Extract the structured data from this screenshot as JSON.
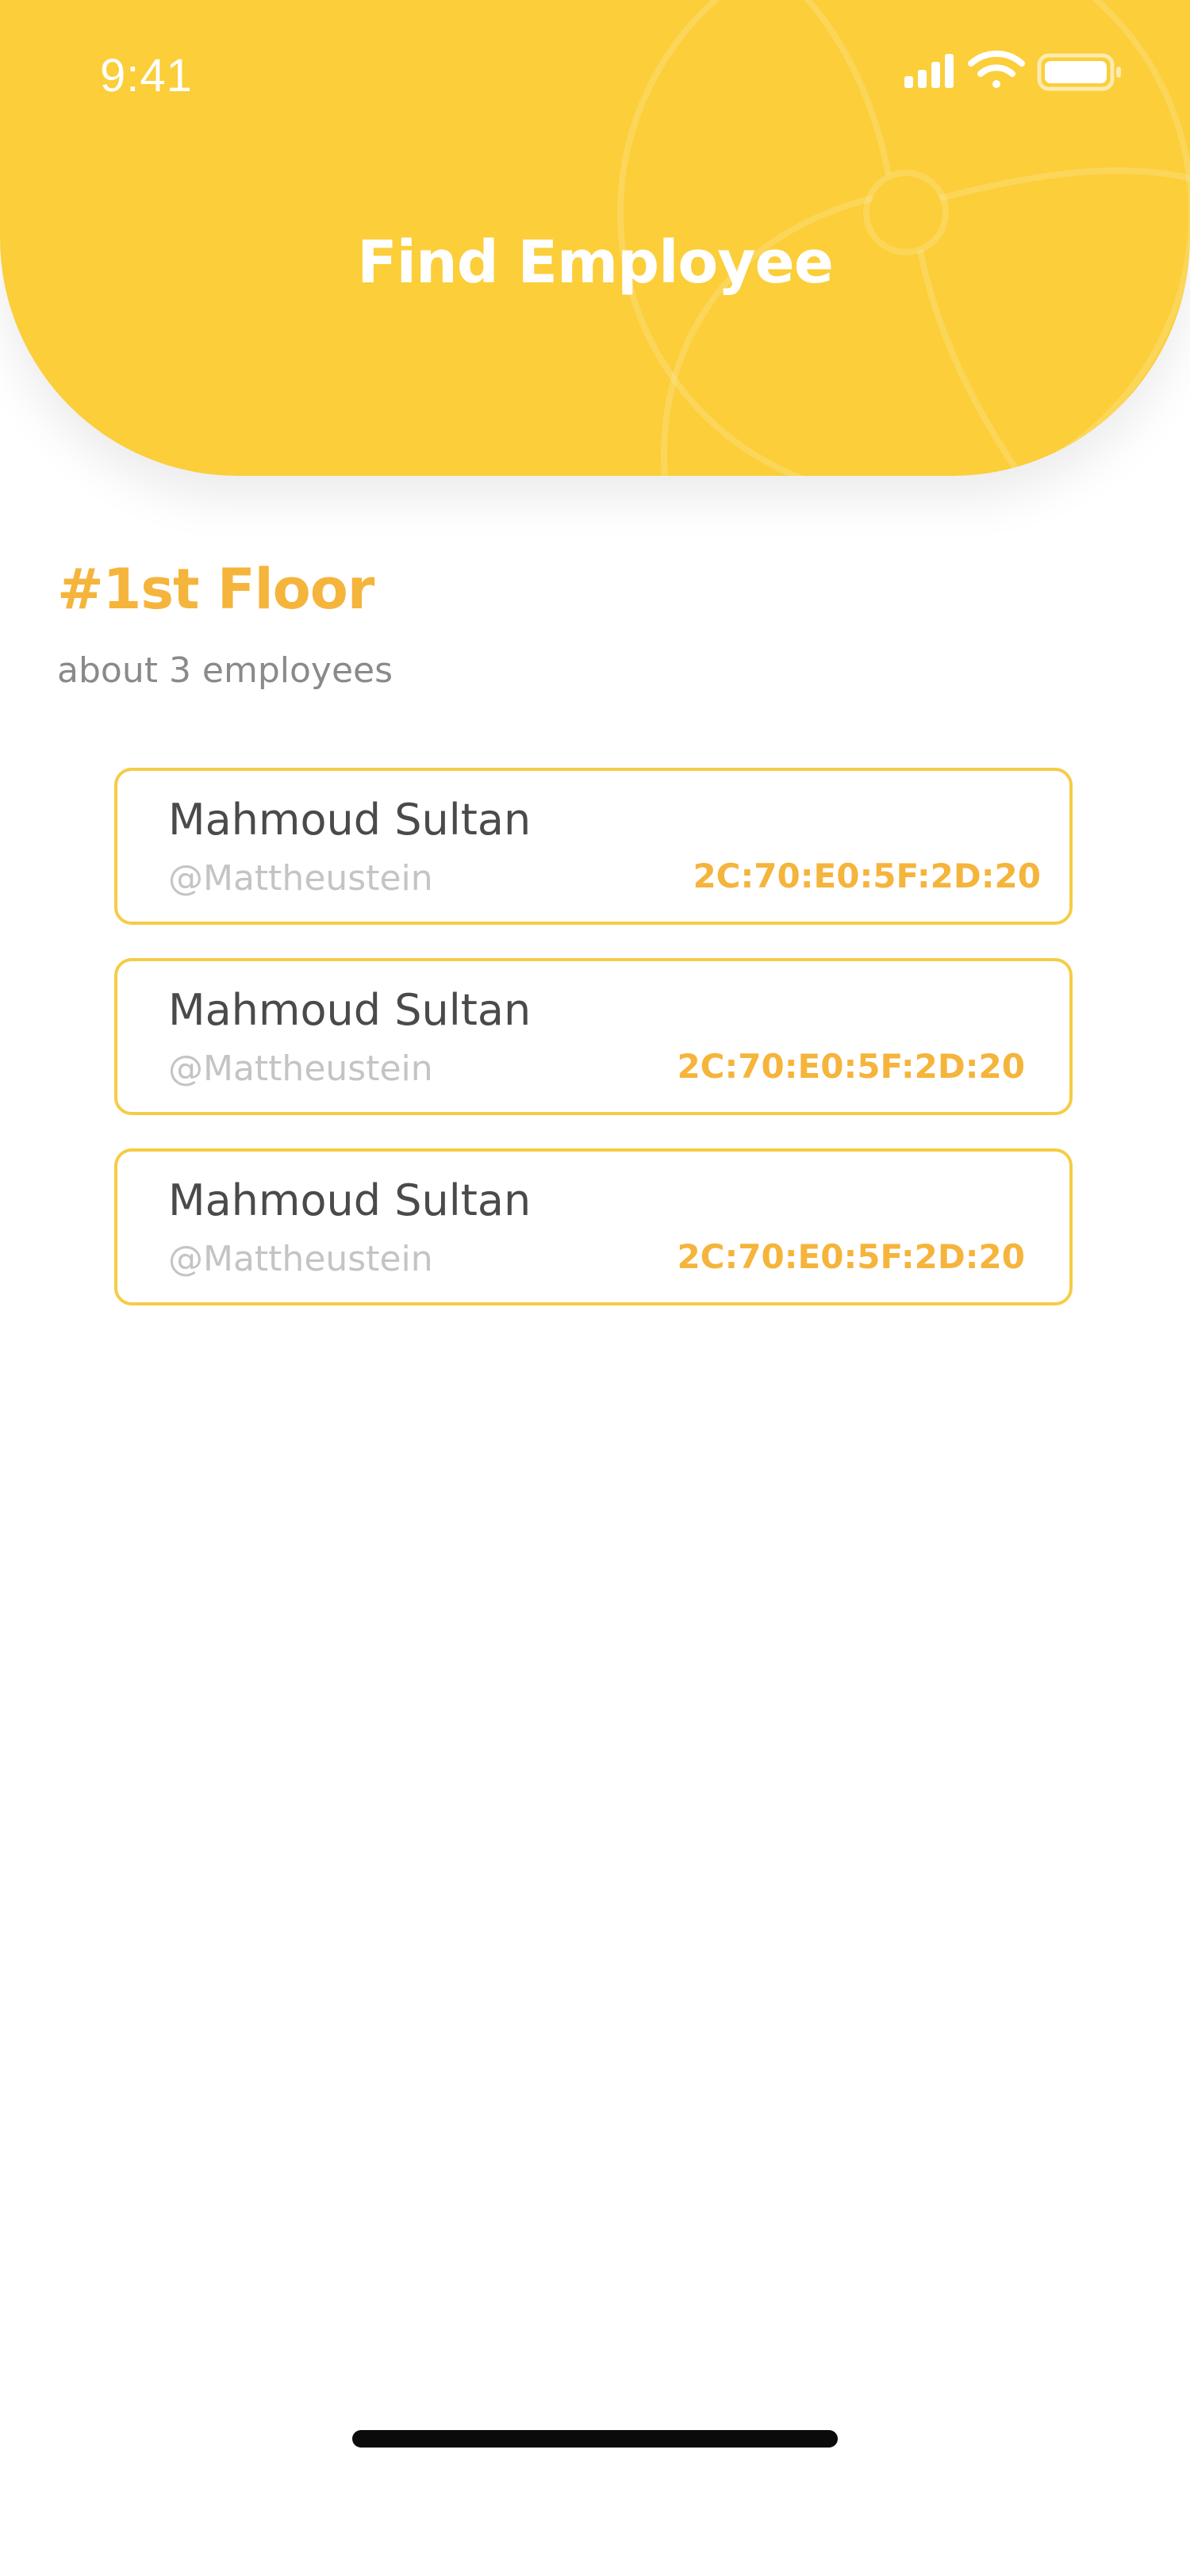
{
  "status_bar": {
    "time": "9:41",
    "icons": [
      "cellular-signal-icon",
      "wifi-icon",
      "battery-icon"
    ]
  },
  "header": {
    "title": "Find Employee",
    "background_color": "#FBCE3A"
  },
  "floor": {
    "title": "#1st Floor",
    "subtitle": "about 3 employees"
  },
  "employees": [
    {
      "name": "Mahmoud Sultan",
      "handle": "@Mattheustein",
      "mac": "2C:70:E0:5F:2D:20"
    },
    {
      "name": "Mahmoud Sultan",
      "handle": "@Mattheustein",
      "mac": "2C:70:E0:5F:2D:20"
    },
    {
      "name": "Mahmoud Sultan",
      "handle": "@Mattheustein",
      "mac": "2C:70:E0:5F:2D:20"
    }
  ],
  "colors": {
    "accent": "#F5B43B",
    "card_border": "#F6CC45",
    "name_text": "#4a4a4a",
    "handle_text": "#c4c4c4"
  }
}
